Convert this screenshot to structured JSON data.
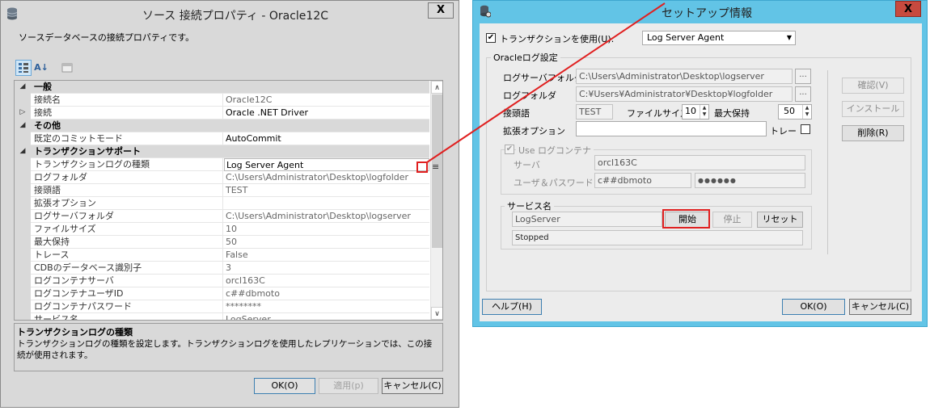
{
  "left_window": {
    "title": "ソース 接続プロパティ - Oracle12C",
    "description": "ソースデータベースの接続プロパティです。",
    "close_label": "X",
    "toolbar": {
      "categorized_label": "",
      "alpha_label": "A↓",
      "pages_label": ""
    },
    "grid_rows": [
      {
        "type": "category",
        "expander": "◢",
        "name": "一般"
      },
      {
        "type": "prop",
        "expander": "",
        "name": "接続名",
        "value": "Oracle12C",
        "style": "dim"
      },
      {
        "type": "prop",
        "expander": "▷",
        "name": "接続",
        "value": "Oracle .NET Driver",
        "style": "dark"
      },
      {
        "type": "category",
        "expander": "◢",
        "name": "その他"
      },
      {
        "type": "prop",
        "expander": "",
        "name": "既定のコミットモード",
        "value": "AutoCommit",
        "style": "dark"
      },
      {
        "type": "category",
        "expander": "◢",
        "name": "トランザクションサポート"
      },
      {
        "type": "prop",
        "expander": "",
        "name": "トランザクションログの種類",
        "value": "Log Server Agent",
        "style": "sel"
      },
      {
        "type": "prop",
        "expander": "",
        "name": "ログフォルダ",
        "value": "C:\\Users\\Administrator\\Desktop\\logfolder",
        "style": "dim"
      },
      {
        "type": "prop",
        "expander": "",
        "name": "接頭語",
        "value": "TEST",
        "style": "dim"
      },
      {
        "type": "prop",
        "expander": "",
        "name": "拡張オプション",
        "value": "",
        "style": "dim"
      },
      {
        "type": "prop",
        "expander": "",
        "name": "ログサーバフォルダ",
        "value": "C:\\Users\\Administrator\\Desktop\\logserver",
        "style": "dim"
      },
      {
        "type": "prop",
        "expander": "",
        "name": "ファイルサイズ",
        "value": "10",
        "style": "dim"
      },
      {
        "type": "prop",
        "expander": "",
        "name": "最大保持",
        "value": "50",
        "style": "dim"
      },
      {
        "type": "prop",
        "expander": "",
        "name": "トレース",
        "value": "False",
        "style": "dim"
      },
      {
        "type": "prop",
        "expander": "",
        "name": "CDBのデータベース識別子",
        "value": "3",
        "style": "dim"
      },
      {
        "type": "prop",
        "expander": "",
        "name": "ログコンテナサーバ",
        "value": "orcl163C",
        "style": "dim"
      },
      {
        "type": "prop",
        "expander": "",
        "name": "ログコンテナユーザID",
        "value": "c##dbmoto",
        "style": "dim"
      },
      {
        "type": "prop",
        "expander": "",
        "name": "ログコンテナパスワード",
        "value": "********",
        "style": "dim"
      },
      {
        "type": "prop",
        "expander": "",
        "name": "サービス名",
        "value": "LogServer",
        "style": "dim"
      }
    ],
    "scroll": {
      "up": "∧",
      "down": "∨"
    },
    "ellipsis_glyph": "≡",
    "help": {
      "title": "トランザクションログの種類",
      "body": "トランザクションログの種類を設定します。トランザクションログを使用したレプリケーションでは、この接続が使用されます。"
    },
    "buttons": {
      "ok": "OK(O)",
      "apply": "適用(p)",
      "cancel": "キャンセル(C)"
    }
  },
  "right_window": {
    "title": "セットアップ情報",
    "close_label": "X",
    "use_transaction_label": "トランザクションを使用(U):",
    "use_transaction_checked": "✔",
    "transaction_type": "Log Server Agent",
    "oracle_group_label": "Oracleログ設定",
    "log_server_folder_label": "ログサーバフォルダ",
    "log_server_folder_value": "C:\\Users\\Administrator\\Desktop\\logserver",
    "log_folder_label": "ログフォルダ",
    "log_folder_value": "C:¥Users¥Administrator¥Desktop¥logfolder",
    "browse_label": "...",
    "prefix_label": "接頭語",
    "prefix_value": "TEST",
    "file_size_label": "ファイルサイズ",
    "file_size_value": "10",
    "max_keep_label": "最大保持",
    "max_keep_value": "50",
    "spin_up": "▲",
    "spin_down": "▼",
    "ext_option_label": "拡張オプション",
    "ext_option_value": "",
    "trace_label": "トレー",
    "use_container_label": "Use ログコンテナ",
    "use_container_checked": "✔",
    "server_label": "サーバ",
    "server_value": "orcl163C",
    "user_pw_label": "ユーザ＆パスワード",
    "user_value": "c##dbmoto",
    "password_value": "●●●●●●",
    "service_group_label": "サービス名",
    "service_name_value": "LogServer",
    "start_label": "開始",
    "stop_label": "停止",
    "reset_label": "リセット",
    "status_value": "Stopped",
    "confirm_label": "確認(V)",
    "install_label": "インストール",
    "delete_label": "削除(R)",
    "help_label": "ヘルプ(H)",
    "ok_label": "OK(O)",
    "cancel_label": "キャンセル(C)"
  },
  "annotation": {
    "color": "#e02020"
  }
}
